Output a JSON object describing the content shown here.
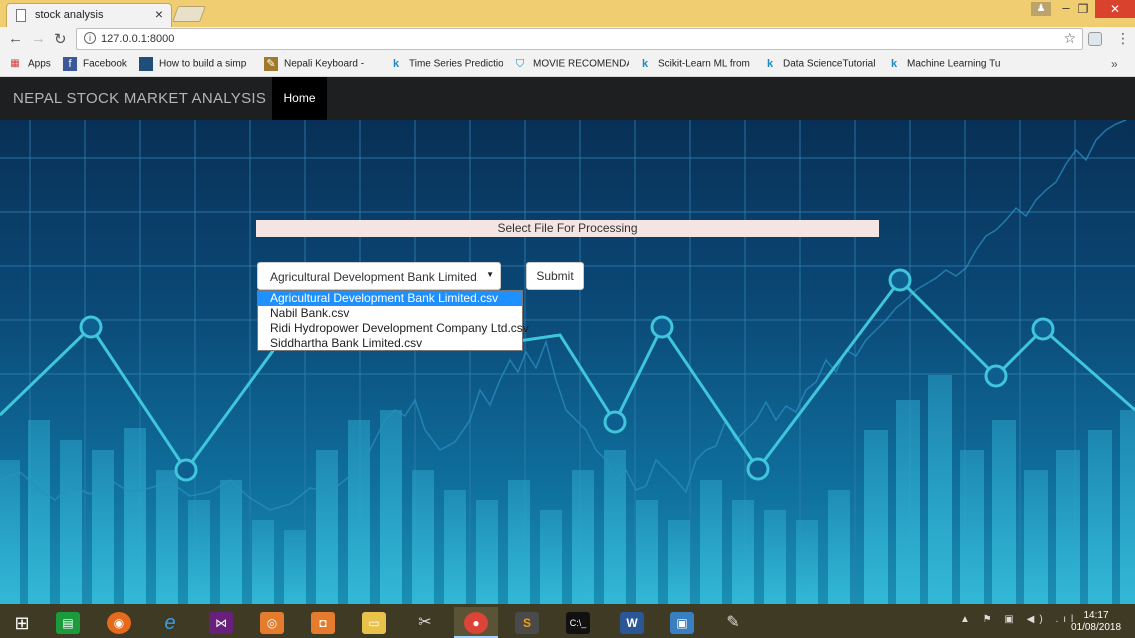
{
  "browser": {
    "tab_title": "stock analysis",
    "tab_close": "×",
    "url": "127.0.0.1:8000",
    "window_user": "♟",
    "window_minimize": "–",
    "window_maximize": "❐",
    "window_close": "✕"
  },
  "bookmarks": {
    "items": [
      {
        "label": "Apps",
        "icon": "apps-grid-icon"
      },
      {
        "label": "Facebook",
        "icon": "facebook-icon"
      },
      {
        "label": "How to build a simp",
        "icon": "page-icon"
      },
      {
        "label": "Nepali Keyboard - ",
        "icon": "keyboard-icon"
      },
      {
        "label": "Time Series Predictio",
        "icon": "kaggle-icon"
      },
      {
        "label": "MOVIE RECOMENDA",
        "icon": "shield-icon"
      },
      {
        "label": "Scikit-Learn ML from",
        "icon": "kaggle-icon"
      },
      {
        "label": "Data ScienceTutorial",
        "icon": "kaggle-icon"
      },
      {
        "label": "Machine Learning Tu",
        "icon": "kaggle-icon"
      }
    ],
    "more": "»"
  },
  "site": {
    "brand": "NEPAL STOCK MARKET ANALYSIS",
    "nav_home": "Home"
  },
  "form": {
    "label": "Select File For Processing",
    "selected": "Agricultural Development Bank Limited.csv",
    "submit": "Submit",
    "options": [
      "Agricultural Development Bank Limited.csv",
      "Nabil Bank.csv",
      "Ridi Hydropower Development Company Ltd.csv",
      "Siddhartha Bank Limited.csv"
    ]
  },
  "taskbar": {
    "time": "14:17",
    "date": "01/08/2018",
    "tray": "▲ ⚑ ▣ ◀) .ıl"
  },
  "colors": {
    "titlebar": "#f1cd72",
    "navbar": "#1e1f20",
    "hero_line": "#3fc6dd",
    "dropdown_selected": "#1e90ff"
  }
}
